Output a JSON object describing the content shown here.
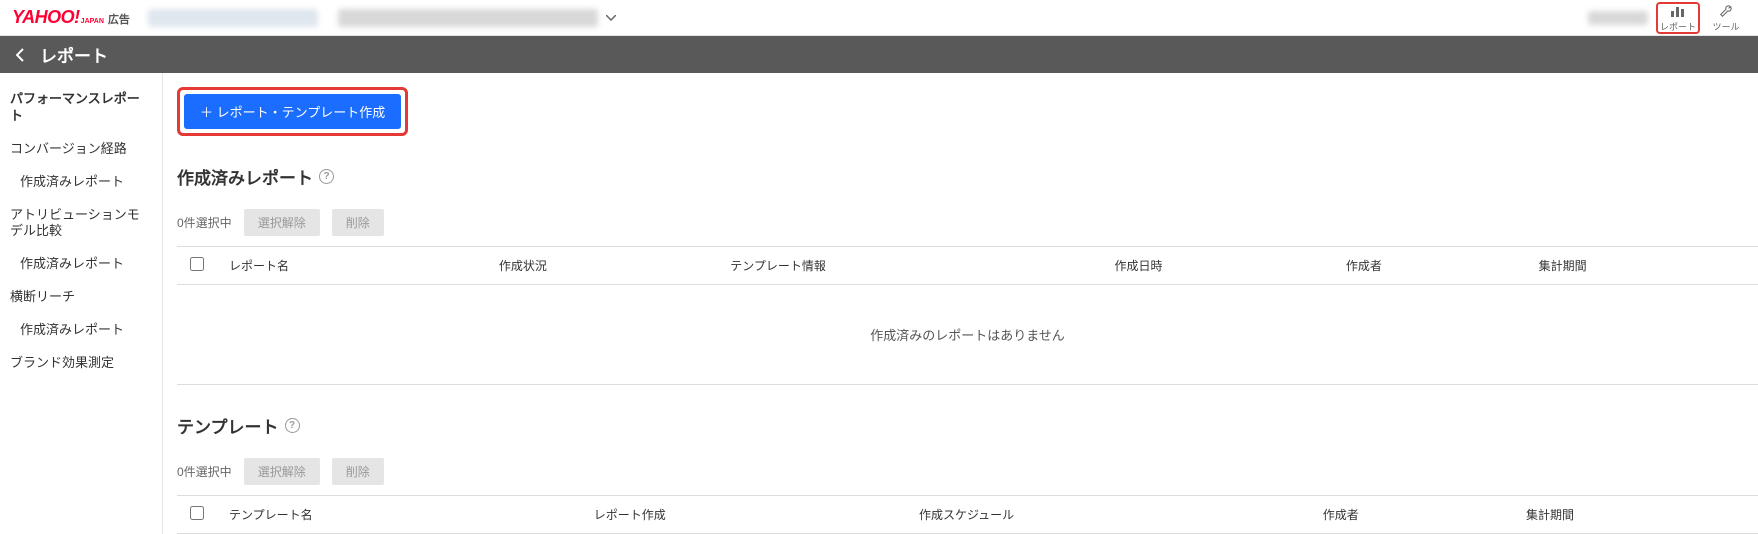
{
  "header": {
    "logo_yahoo": "YAHOO!",
    "logo_japan": "JAPAN",
    "logo_ad": "広告",
    "report_btn": "レポート",
    "tool_btn": "ツール"
  },
  "page_bar": {
    "title": "レポート"
  },
  "sidebar": {
    "items": [
      {
        "label": "パフォーマンスレポート",
        "indent": false,
        "active": true
      },
      {
        "label": "コンバージョン経路",
        "indent": false,
        "active": false
      },
      {
        "label": "作成済みレポート",
        "indent": true,
        "active": false
      },
      {
        "label": "アトリビューションモデル比較",
        "indent": false,
        "active": false
      },
      {
        "label": "作成済みレポート",
        "indent": true,
        "active": false
      },
      {
        "label": "横断リーチ",
        "indent": false,
        "active": false
      },
      {
        "label": "作成済みレポート",
        "indent": true,
        "active": false
      },
      {
        "label": "ブランド効果測定",
        "indent": false,
        "active": false
      }
    ]
  },
  "main": {
    "create_btn": "＋ レポート・テンプレート作成",
    "reports": {
      "title": "作成済みレポート",
      "selected_count": "0件選択中",
      "clear_btn": "選択解除",
      "delete_btn": "削除",
      "columns": [
        "レポート名",
        "作成状況",
        "テンプレート情報",
        "作成日時",
        "作成者",
        "集計期間"
      ],
      "empty_msg": "作成済みのレポートはありません"
    },
    "templates": {
      "title": "テンプレート",
      "selected_count": "0件選択中",
      "clear_btn": "選択解除",
      "delete_btn": "削除",
      "columns": [
        "テンプレート名",
        "レポート作成",
        "作成スケジュール",
        "作成者",
        "集計期間"
      ]
    }
  }
}
